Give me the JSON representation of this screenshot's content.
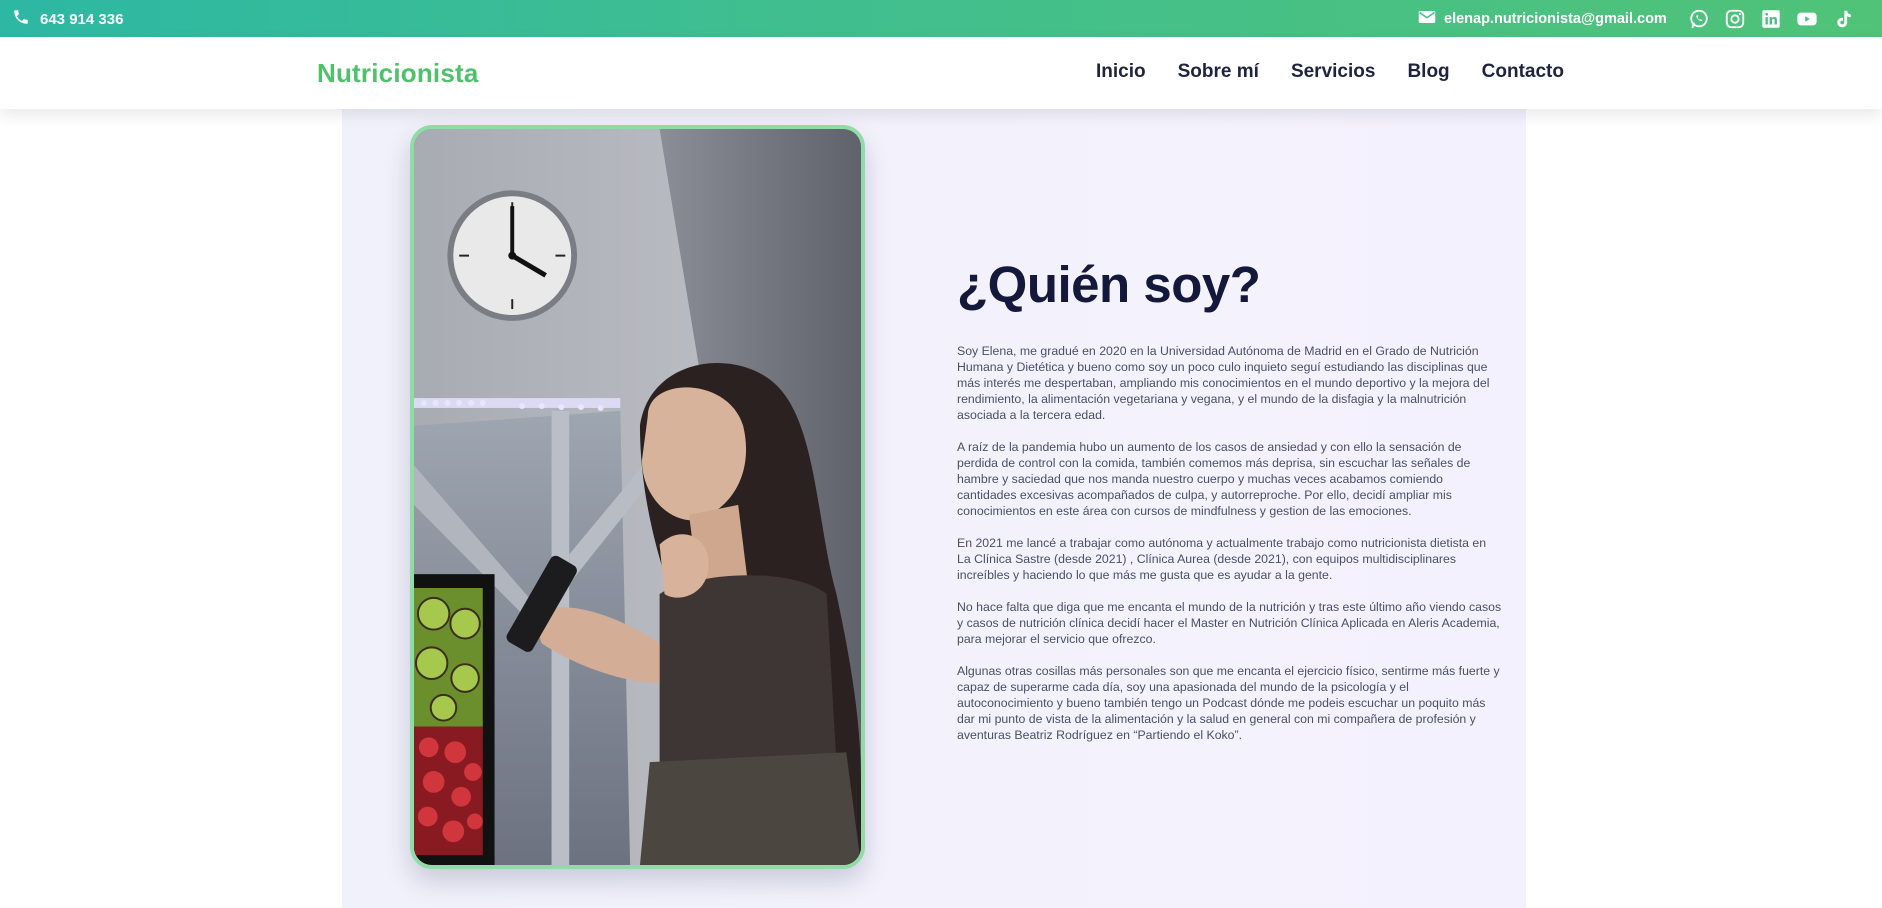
{
  "topbar": {
    "phone": "643 914 336",
    "email": "elenap.nutricionista@gmail.com",
    "socials": [
      "whatsapp-icon",
      "instagram-icon",
      "linkedin-icon",
      "youtube-icon",
      "tiktok-icon"
    ]
  },
  "header": {
    "brand": "Nutricionista",
    "nav": [
      "Inicio",
      "Sobre mí",
      "Servicios",
      "Blog",
      "Contacto"
    ]
  },
  "about": {
    "title": "¿Quién soy?",
    "paragraphs": [
      "Soy Elena, me gradué en 2020 en la Universidad Autónoma de Madrid en el Grado de Nutrición Humana y Dietética y bueno como soy un poco culo inquieto seguí estudiando las disciplinas que más interés me despertaban, ampliando mis conocimientos en el mundo deportivo y la mejora del rendimiento, la alimentación vegetariana y vegana, y el mundo de la disfagia y la malnutrición asociada a la tercera edad.",
      "A raíz de la pandemia hubo un aumento de los casos de ansiedad y con ello la sensación de perdida de control con la comida, también comemos más deprisa, sin escuchar las señales de hambre y saciedad que nos manda nuestro cuerpo y muchas veces acabamos comiendo cantidades excesivas acompañados de culpa, y autorreproche. Por ello, decidí ampliar mis conocimientos en este área con cursos de mindfulness y gestion de las emociones.",
      "En 2021 me lancé a trabajar como autónoma y actualmente trabajo como nutricionista dietista en La Clínica Sastre (desde 2021) , Clínica Aurea (desde 2021), con equipos multidisciplinares increíbles y haciendo lo que más me gusta que es ayudar a la gente.",
      "No hace falta que diga que me encanta el mundo de la nutrición y tras este último año viendo casos y casos de nutrición clínica decidí hacer el Master en Nutrición Clínica Aplicada en Aleris Academia, para mejorar el servicio que ofrezco.",
      "Algunas otras cosillas más personales son que me encanta el ejercicio físico, sentirme más fuerte y capaz de superarme cada día, soy una apasionada del mundo de la psicología y el autoconocimiento y bueno también tengo un Podcast dónde me podeis escuchar un poquito más dar mi punto de vista de la alimentación y la salud en general con mi compañera de profesión y aventuras Beatriz Rodríguez en “Partiendo el Koko”."
    ]
  },
  "colors": {
    "brand_green": "#4fc16a",
    "topbar_start": "#2db8a4",
    "topbar_end": "#50c378",
    "photo_border": "#8fdca6",
    "title": "#14183a"
  }
}
